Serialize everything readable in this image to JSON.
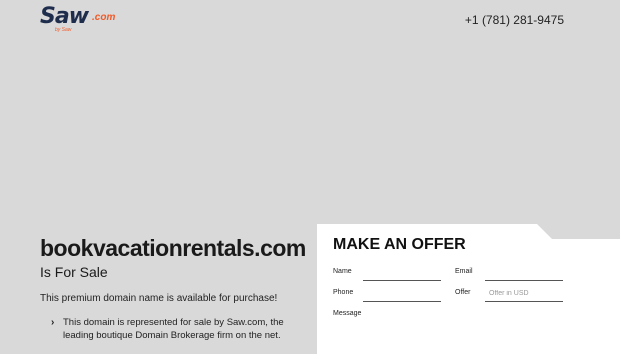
{
  "header": {
    "logo": {
      "main": "Saw",
      "suffix": ".com",
      "tagline": "by Saw"
    },
    "phone": "+1 (781) 281-9475"
  },
  "hero": {
    "domain": "bookvacationrentals.com",
    "subtitle": "Is For Sale",
    "description": "This premium domain name is available for purchase!",
    "bullet": "This domain is represented for sale by Saw.com, the leading boutique Domain Brokerage firm on the net."
  },
  "offer_form": {
    "heading": "MAKE AN OFFER",
    "name_label": "Name",
    "email_label": "Email",
    "phone_label": "Phone",
    "offer_label": "Offer",
    "offer_placeholder": "Offer in USD",
    "message_label": "Message"
  },
  "colors": {
    "background": "#d9d9d9",
    "brand_navy": "#1f2d4d",
    "brand_orange": "#f05a28",
    "card": "#ffffff"
  }
}
